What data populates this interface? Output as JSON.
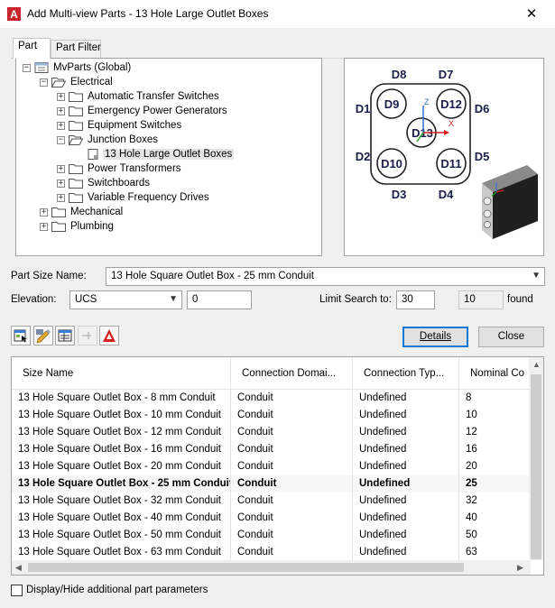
{
  "window": {
    "title": "Add Multi-view Parts - 13 Hole Large Outlet Boxes",
    "close_glyph": "✕"
  },
  "tabs": [
    {
      "label": "Part",
      "active": true
    },
    {
      "label": "Part Filter",
      "active": false
    }
  ],
  "tree": [
    {
      "label": "MvParts (Global)",
      "level": 0,
      "expander": "−",
      "icon": "catalog-icon"
    },
    {
      "label": "Electrical",
      "level": 1,
      "expander": "−",
      "icon": "folder-open-icon"
    },
    {
      "label": "Automatic Transfer Switches",
      "level": 2,
      "expander": "+",
      "icon": "folder-icon"
    },
    {
      "label": "Emergency Power Generators",
      "level": 2,
      "expander": "+",
      "icon": "folder-icon"
    },
    {
      "label": "Equipment Switches",
      "level": 2,
      "expander": "+",
      "icon": "folder-icon"
    },
    {
      "label": "Junction Boxes",
      "level": 2,
      "expander": "−",
      "icon": "folder-open-icon"
    },
    {
      "label": "13 Hole Large Outlet Boxes",
      "level": 3,
      "expander": "",
      "icon": "part-icon",
      "selected": true
    },
    {
      "label": "Power Transformers",
      "level": 2,
      "expander": "+",
      "icon": "folder-icon"
    },
    {
      "label": "Switchboards",
      "level": 2,
      "expander": "+",
      "icon": "folder-icon"
    },
    {
      "label": "Variable Frequency Drives",
      "level": 2,
      "expander": "+",
      "icon": "folder-icon"
    },
    {
      "label": "Mechanical",
      "level": 1,
      "expander": "+",
      "icon": "folder-icon"
    },
    {
      "label": "Plumbing",
      "level": 1,
      "expander": "+",
      "icon": "folder-icon"
    }
  ],
  "preview": {
    "labels": {
      "d1": "D1",
      "d2": "D2",
      "d3": "D3",
      "d4": "D4",
      "d5": "D5",
      "d6": "D6",
      "d7": "D7",
      "d8": "D8",
      "d9": "D9",
      "d10": "D10",
      "d11": "D11",
      "d12": "D12",
      "d13": "D13"
    },
    "axis_z": "Z",
    "axis_x": "X"
  },
  "part_size": {
    "label": "Part Size Name:",
    "value": "13 Hole Square Outlet Box - 25 mm Conduit"
  },
  "elevation": {
    "label": "Elevation:",
    "combo_value": "UCS",
    "value": "0"
  },
  "limit_search": {
    "label": "Limit Search to:",
    "value": "30",
    "found_count": "10",
    "found_label": "found"
  },
  "toolbar": {
    "buttons": [
      "catalog-browse-icon",
      "pencil-edit-icon",
      "list-view-icon",
      "insert-disabled-icon",
      "autocad-icon"
    ]
  },
  "buttons": {
    "details": "Details",
    "close": "Close"
  },
  "grid": {
    "columns": [
      "Size Name",
      "Connection Domai...",
      "Connection Typ...",
      "Nominal Co"
    ],
    "rows": [
      [
        "13 Hole Square Outlet Box - 8 mm Conduit",
        "Conduit",
        "Undefined",
        "8"
      ],
      [
        "13 Hole Square Outlet Box - 10 mm Conduit",
        "Conduit",
        "Undefined",
        "10"
      ],
      [
        "13 Hole Square Outlet Box - 12 mm Conduit",
        "Conduit",
        "Undefined",
        "12"
      ],
      [
        "13 Hole Square Outlet Box - 16 mm Conduit",
        "Conduit",
        "Undefined",
        "16"
      ],
      [
        "13 Hole Square Outlet Box - 20 mm Conduit",
        "Conduit",
        "Undefined",
        "20"
      ],
      [
        "13 Hole Square Outlet Box - 25 mm Conduit",
        "Conduit",
        "Undefined",
        "25"
      ],
      [
        "13 Hole Square Outlet Box - 32 mm Conduit",
        "Conduit",
        "Undefined",
        "32"
      ],
      [
        "13 Hole Square Outlet Box - 40 mm Conduit",
        "Conduit",
        "Undefined",
        "40"
      ],
      [
        "13 Hole Square Outlet Box - 50 mm Conduit",
        "Conduit",
        "Undefined",
        "50"
      ],
      [
        "13 Hole Square Outlet Box - 63 mm Conduit",
        "Conduit",
        "Undefined",
        "63"
      ]
    ],
    "selected_row": 5
  },
  "footer": {
    "checkbox_label": "Display/Hide additional part parameters",
    "checked": false
  },
  "colors": {
    "accent": "#0078d7",
    "autocad_red": "#d42020"
  }
}
